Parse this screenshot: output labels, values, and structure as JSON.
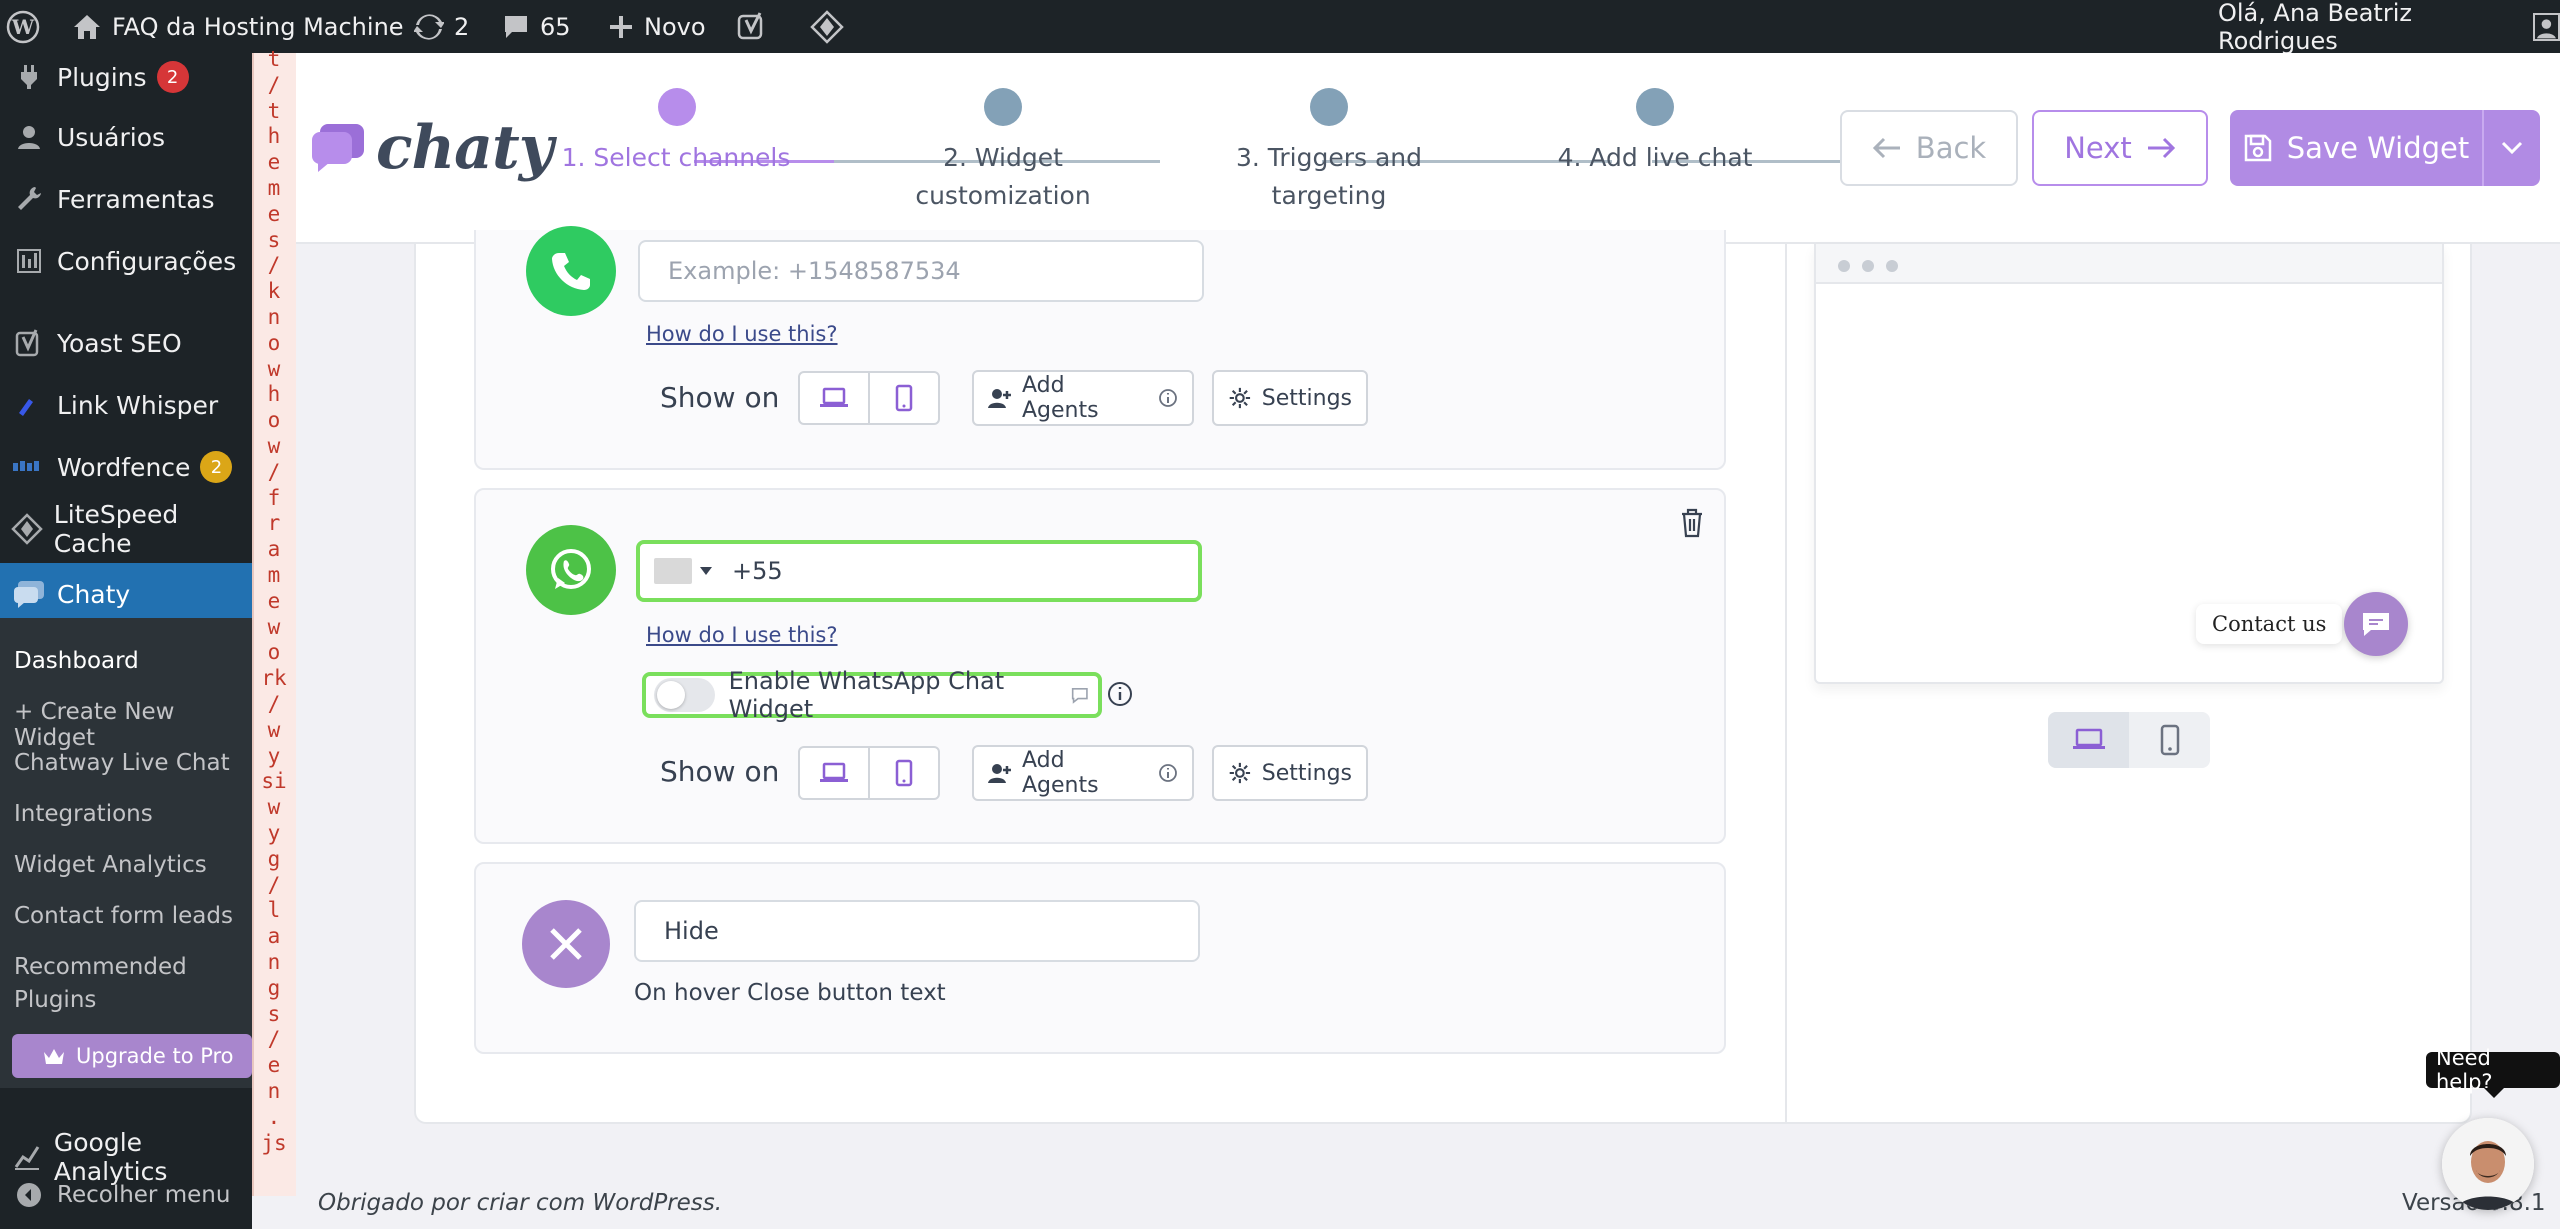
{
  "adminbar": {
    "site_name": "FAQ da Hosting Machine",
    "updates_count": "2",
    "comments_count": "65",
    "new_label": "Novo",
    "greeting": "Olá, Ana Beatriz Rodrigues"
  },
  "sidebar": {
    "items": [
      {
        "label": "Plugins",
        "badge": "2",
        "icon": "plugin-icon"
      },
      {
        "label": "Usuários",
        "icon": "user-icon"
      },
      {
        "label": "Ferramentas",
        "icon": "wrench-icon"
      },
      {
        "label": "Configurações",
        "icon": "settings-icon"
      },
      {
        "label": "Yoast SEO",
        "icon": "yoast-icon"
      },
      {
        "label": "Link Whisper",
        "icon": "link-icon"
      },
      {
        "label": "Wordfence",
        "badge": "2",
        "icon": "wordfence-icon"
      },
      {
        "label": "LiteSpeed Cache",
        "icon": "litespeed-icon"
      },
      {
        "label": "Chaty",
        "icon": "chat-icon"
      }
    ],
    "submenu": [
      "Dashboard",
      "+ Create New Widget",
      "Chatway Live Chat",
      "Integrations",
      "Widget Analytics",
      "Contact form leads",
      "Recommended",
      "Plugins"
    ],
    "upgrade_label": "Upgrade to Pro",
    "bottom_items": [
      {
        "label": "Google Analytics",
        "icon": "analytics-icon"
      },
      {
        "label": "Recolher menu",
        "icon": "collapse-icon"
      }
    ]
  },
  "path_strip": [
    "t",
    "/",
    "t",
    "h",
    "e",
    "m",
    "e",
    "s",
    "/",
    "k",
    "n",
    "o",
    "w",
    "h",
    "o",
    "w",
    "/",
    "f",
    "r",
    "a",
    "m",
    "e",
    "w",
    "o",
    "rk",
    "/",
    "w",
    "y",
    "si",
    "w",
    "y",
    "g",
    "/",
    "l",
    "a",
    "n",
    "g",
    "s",
    "/",
    "e",
    "n",
    ".",
    "js"
  ],
  "header": {
    "logo_text": "chaty",
    "steps": [
      {
        "label_line1": "1. Select channels",
        "label_line2": ""
      },
      {
        "label_line1": "2. Widget",
        "label_line2": "customization"
      },
      {
        "label_line1": "3. Triggers and",
        "label_line2": "targeting"
      },
      {
        "label_line1": "4. Add live chat",
        "label_line2": ""
      }
    ],
    "back_label": "Back",
    "next_label": "Next",
    "save_label": "Save Widget"
  },
  "channels": {
    "phone": {
      "placeholder": "Example: +1548587534",
      "help_link": "How do I use this?",
      "show_on": "Show on",
      "add_agents": "Add Agents",
      "settings": "Settings"
    },
    "whatsapp": {
      "value": "+55",
      "help_link": "How do I use this?",
      "toggle_label": "Enable WhatsApp Chat Widget",
      "show_on": "Show on",
      "add_agents": "Add Agents",
      "settings": "Settings"
    },
    "close": {
      "value": "Hide",
      "caption": "On hover Close button text"
    }
  },
  "preview": {
    "contact_label": "Contact us"
  },
  "footer": {
    "left": "Obrigado por criar com WordPress.",
    "right": "Versão 6.8.1",
    "need_help": "Need help?"
  },
  "colors": {
    "accent": "#b78deb",
    "whatsapp": "#4dc247",
    "admin_bg": "#1d2327",
    "active_menu": "#2271b1"
  }
}
